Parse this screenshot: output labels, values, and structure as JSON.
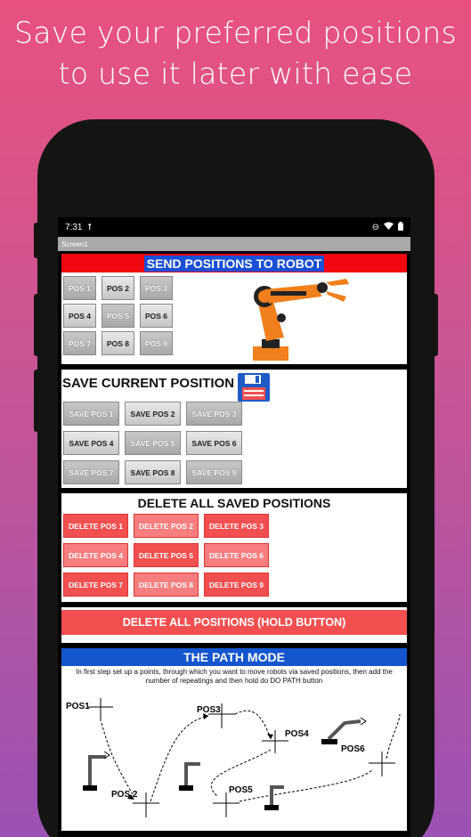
{
  "headline": "Save your preferred positions to use it later with ease",
  "status": {
    "time": "7:31"
  },
  "appbar": {
    "title": "Screen1"
  },
  "send": {
    "title": "SEND POSITIONS TO ROBOT",
    "buttons": [
      "POS 1",
      "POS 2",
      "POS 3",
      "POS 4",
      "POS 5",
      "POS 6",
      "POS 7",
      "POS 8",
      "POS 9"
    ]
  },
  "save": {
    "title": "SAVE CURRENT POSITION",
    "buttons": [
      "SAVE POS 1",
      "SAVE POS 2",
      "SAVE POS 3",
      "SAVE POS 4",
      "SAVE POS 5",
      "SAVE POS 6",
      "SAVE POS 7",
      "SAVE POS 8",
      "SAVE POS 9"
    ]
  },
  "delete": {
    "title": "DELETE ALL SAVED POSITIONS",
    "buttons": [
      "DELETE POS 1",
      "DELETE POS 2",
      "DELETE POS 3",
      "DELETE POS 4",
      "DELETE POS 5",
      "DELETE POS 6",
      "DELETE POS 7",
      "DELETE POS 8",
      "DELETE POS 9"
    ],
    "all_label": "DELETE ALL POSITIONS (HOLD BUTTON)"
  },
  "path": {
    "title": "THE PATH MODE",
    "description": "In first step set up a points, through which you want to move robots via saved positions, then add the number of repeatings and then hold do DO PATH button",
    "labels": {
      "pos1": "POS1",
      "pos2": "POS 2",
      "pos3": "POS3",
      "pos4": "POS4",
      "pos5": "POS5",
      "pos6": "POS6"
    }
  },
  "colors": {
    "red": "#f2060f",
    "blue": "#1556cf",
    "delete": "#f25050",
    "robot": "#f07f1d"
  }
}
